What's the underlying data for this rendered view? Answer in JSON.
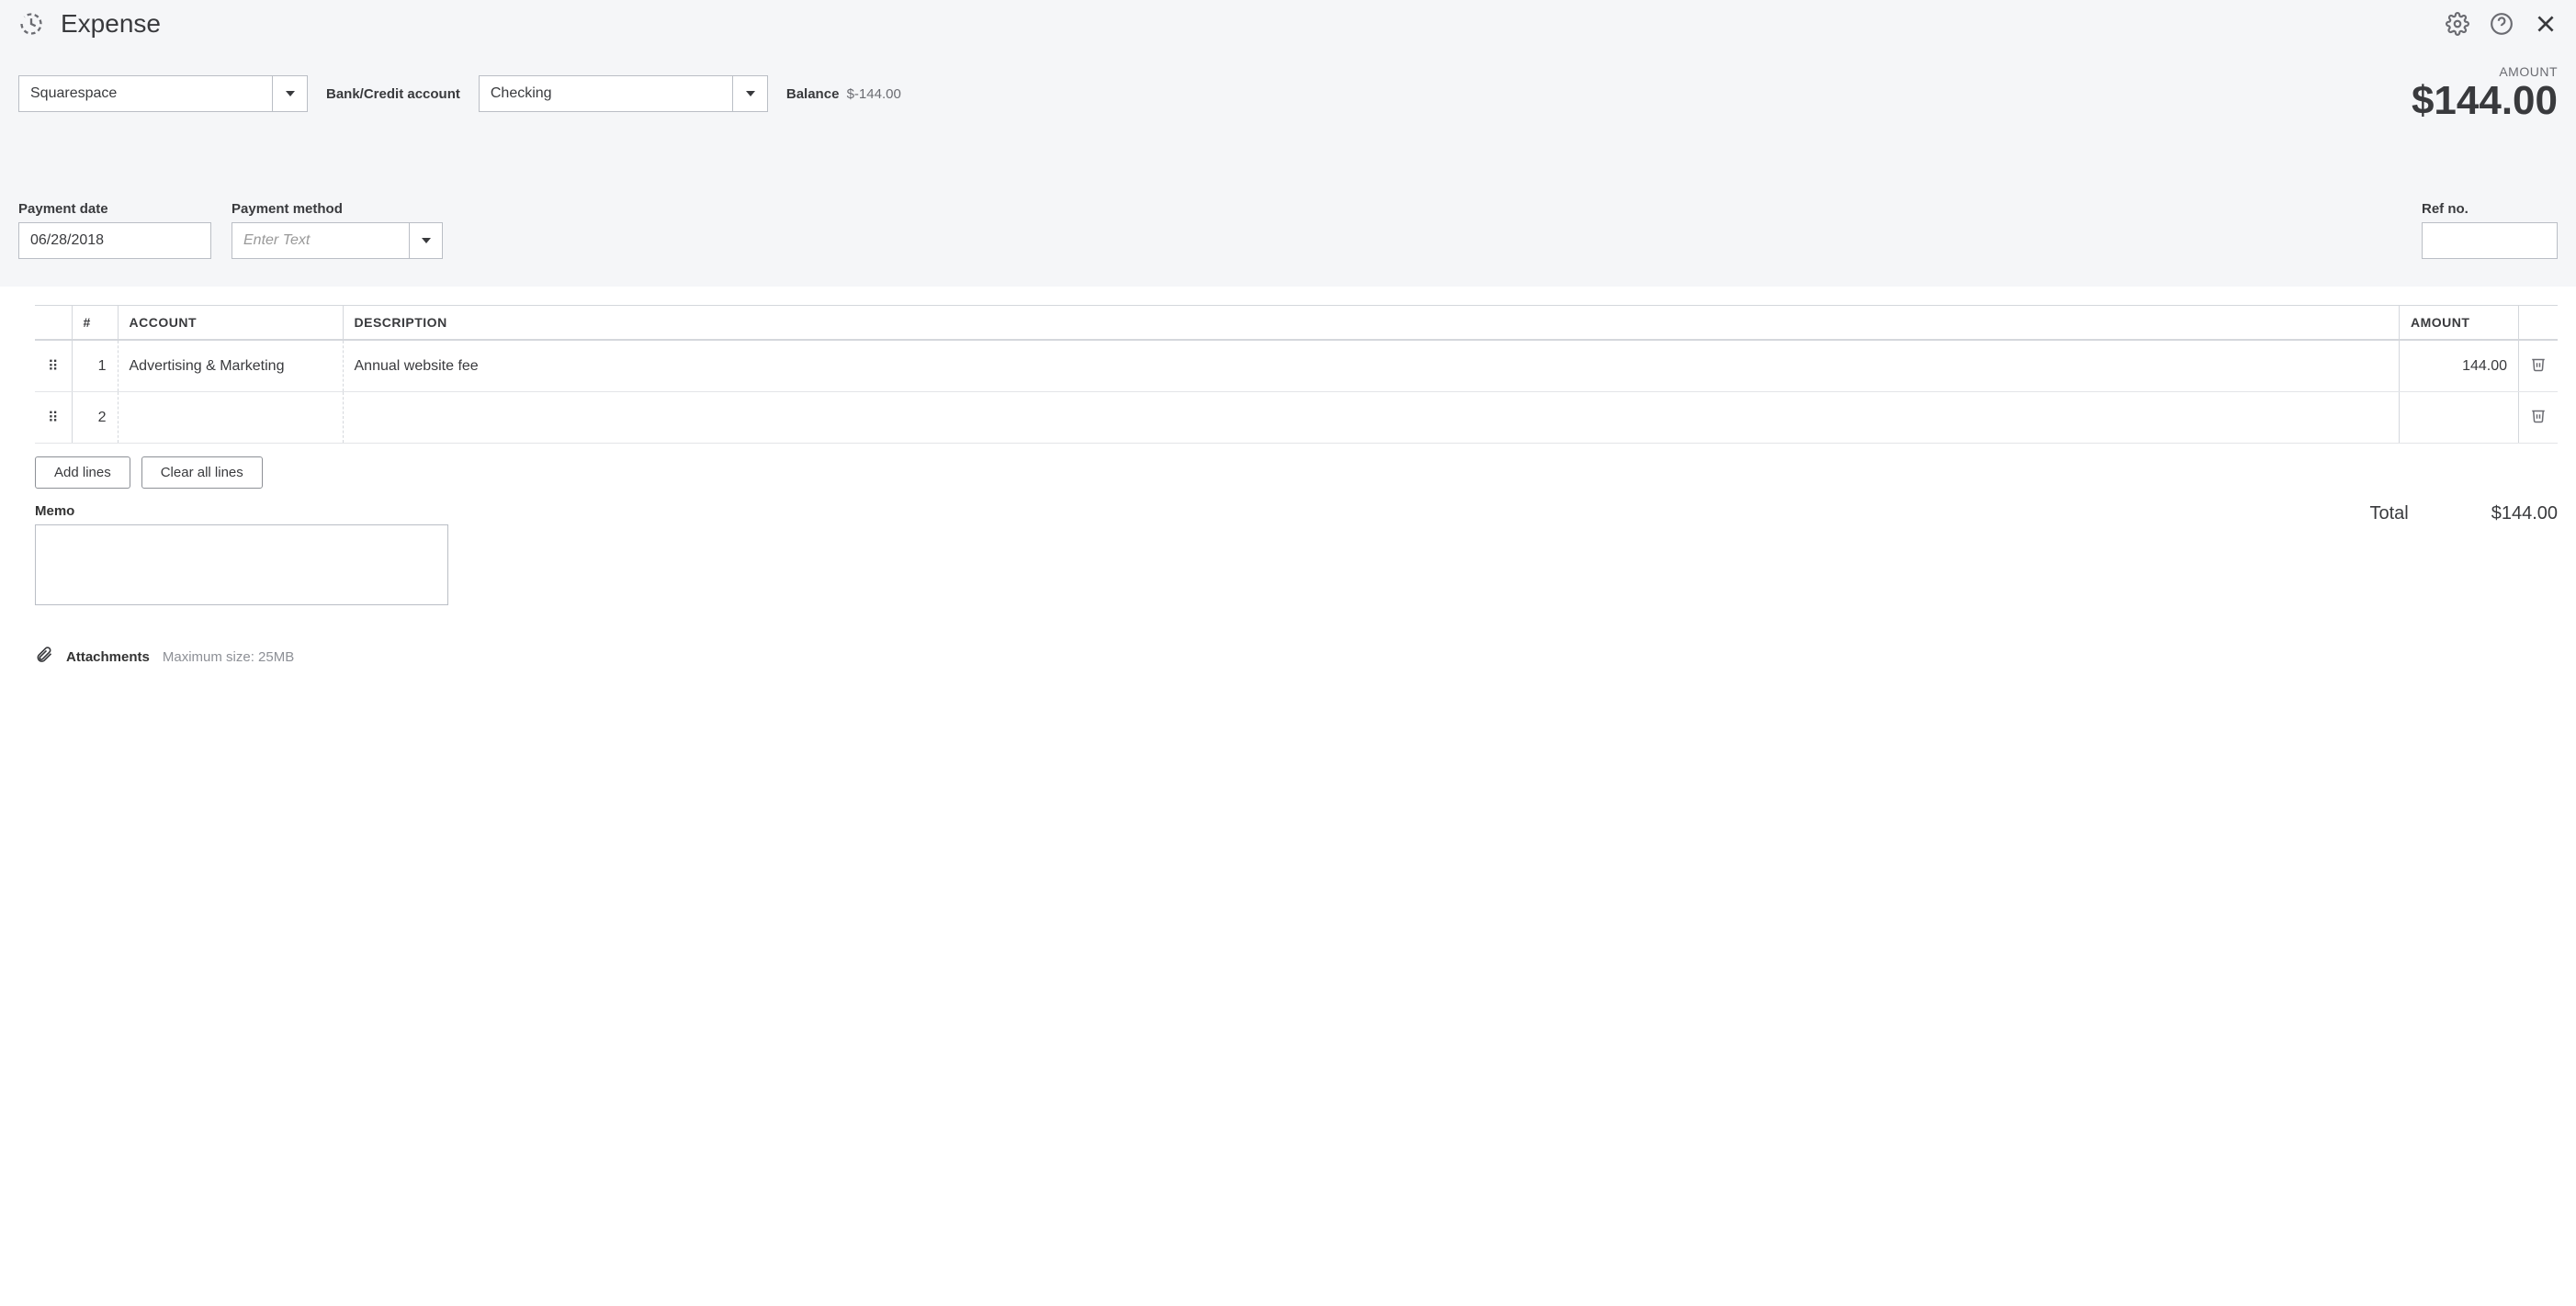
{
  "header": {
    "title": "Expense"
  },
  "form": {
    "payee": "Squarespace",
    "bank_label": "Bank/Credit account",
    "bank_account": "Checking",
    "balance_label": "Balance",
    "balance_value": "$-144.00",
    "amount_caption": "AMOUNT",
    "amount_value": "$144.00",
    "payment_date_label": "Payment date",
    "payment_date": "06/28/2018",
    "payment_method_label": "Payment method",
    "payment_method_placeholder": "Enter Text",
    "payment_method": "",
    "ref_label": "Ref no.",
    "ref_value": ""
  },
  "table": {
    "headers": {
      "num": "#",
      "account": "ACCOUNT",
      "description": "DESCRIPTION",
      "amount": "AMOUNT"
    },
    "rows": [
      {
        "num": "1",
        "account": "Advertising & Marketing",
        "description": "Annual website fee",
        "amount": "144.00"
      },
      {
        "num": "2",
        "account": "",
        "description": "",
        "amount": ""
      }
    ]
  },
  "buttons": {
    "add_lines": "Add lines",
    "clear_lines": "Clear all lines"
  },
  "memo": {
    "label": "Memo",
    "value": ""
  },
  "total": {
    "label": "Total",
    "value": "$144.00"
  },
  "attachments": {
    "label": "Attachments",
    "hint": "Maximum size: 25MB"
  }
}
